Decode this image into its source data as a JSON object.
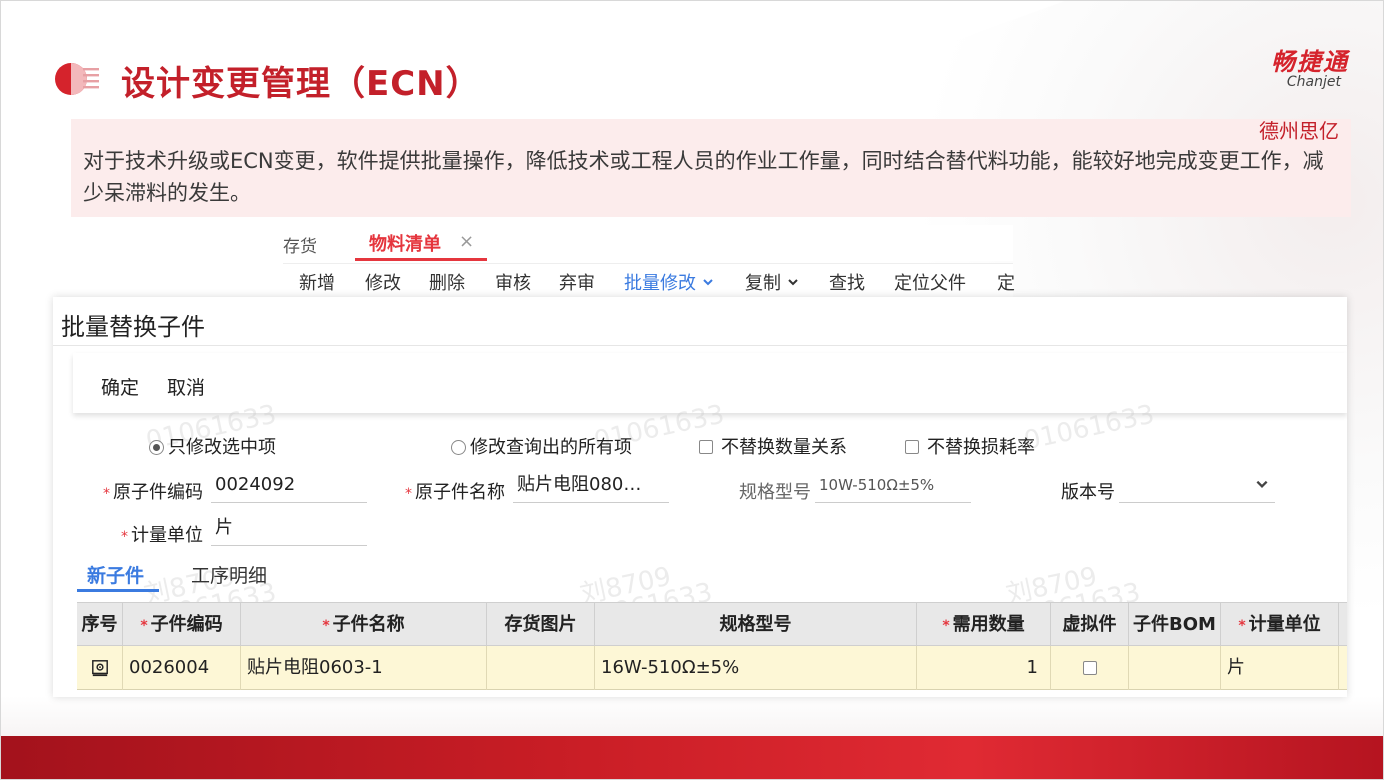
{
  "slide": {
    "title": "设计变更管理（ECN）",
    "brand_cn": "畅捷通",
    "brand_en": "Chanjet",
    "author": "德州思亿",
    "intro": "对于技术升级或ECN变更，软件提供批量操作，降低技术或工程人员的作业工作量，同时结合替代料功能，能较好地完成变更工作，减少呆滞料的发生。"
  },
  "app": {
    "tabs": {
      "prev_label": "存货",
      "active_label": "物料清单",
      "close_symbol": "×"
    },
    "toolbar": [
      "新增",
      "修改",
      "删除",
      "审核",
      "弃审",
      "批量修改",
      "复制",
      "查找",
      "定位父件",
      "定"
    ],
    "toolbar_dropdown_marker": "⌄"
  },
  "dialog": {
    "title": "批量替换子件",
    "confirm_label": "确定",
    "cancel_label": "取消",
    "options": {
      "only_selected": "只修改选中项",
      "all_queried": "修改查询出的所有项",
      "keep_qty_relation": "不替换数量关系",
      "keep_loss_rate": "不替换损耗率"
    },
    "fields": {
      "orig_code_label": "原子件编码",
      "orig_code_value": "0024092",
      "orig_name_label": "原子件名称",
      "orig_name_value": "贴片电阻080…",
      "spec_label": "规格型号",
      "spec_value": "10W-510Ω±5%",
      "version_label": "版本号",
      "version_value": "",
      "unit_label": "计量单位",
      "unit_value": "片"
    },
    "subtabs": {
      "new_child": "新子件",
      "process_detail": "工序明细"
    },
    "grid": {
      "headers": [
        "序号",
        "子件编码",
        "子件名称",
        "存货图片",
        "规格型号",
        "需用数量",
        "虚拟件",
        "子件BOM",
        "计量单位"
      ],
      "rows": [
        {
          "code": "0026004",
          "name": "贴片电阻0603-1",
          "image": "",
          "spec": "16W-510Ω±5%",
          "qty": "1",
          "bom": "",
          "unit": "片"
        }
      ]
    },
    "watermarks": [
      "01061633",
      "刘8709"
    ]
  },
  "colors": {
    "accent_red": "#c3202a",
    "tab_red": "#e5363e",
    "link_blue": "#3b7be0",
    "row_highlight": "#fdf7d6"
  }
}
